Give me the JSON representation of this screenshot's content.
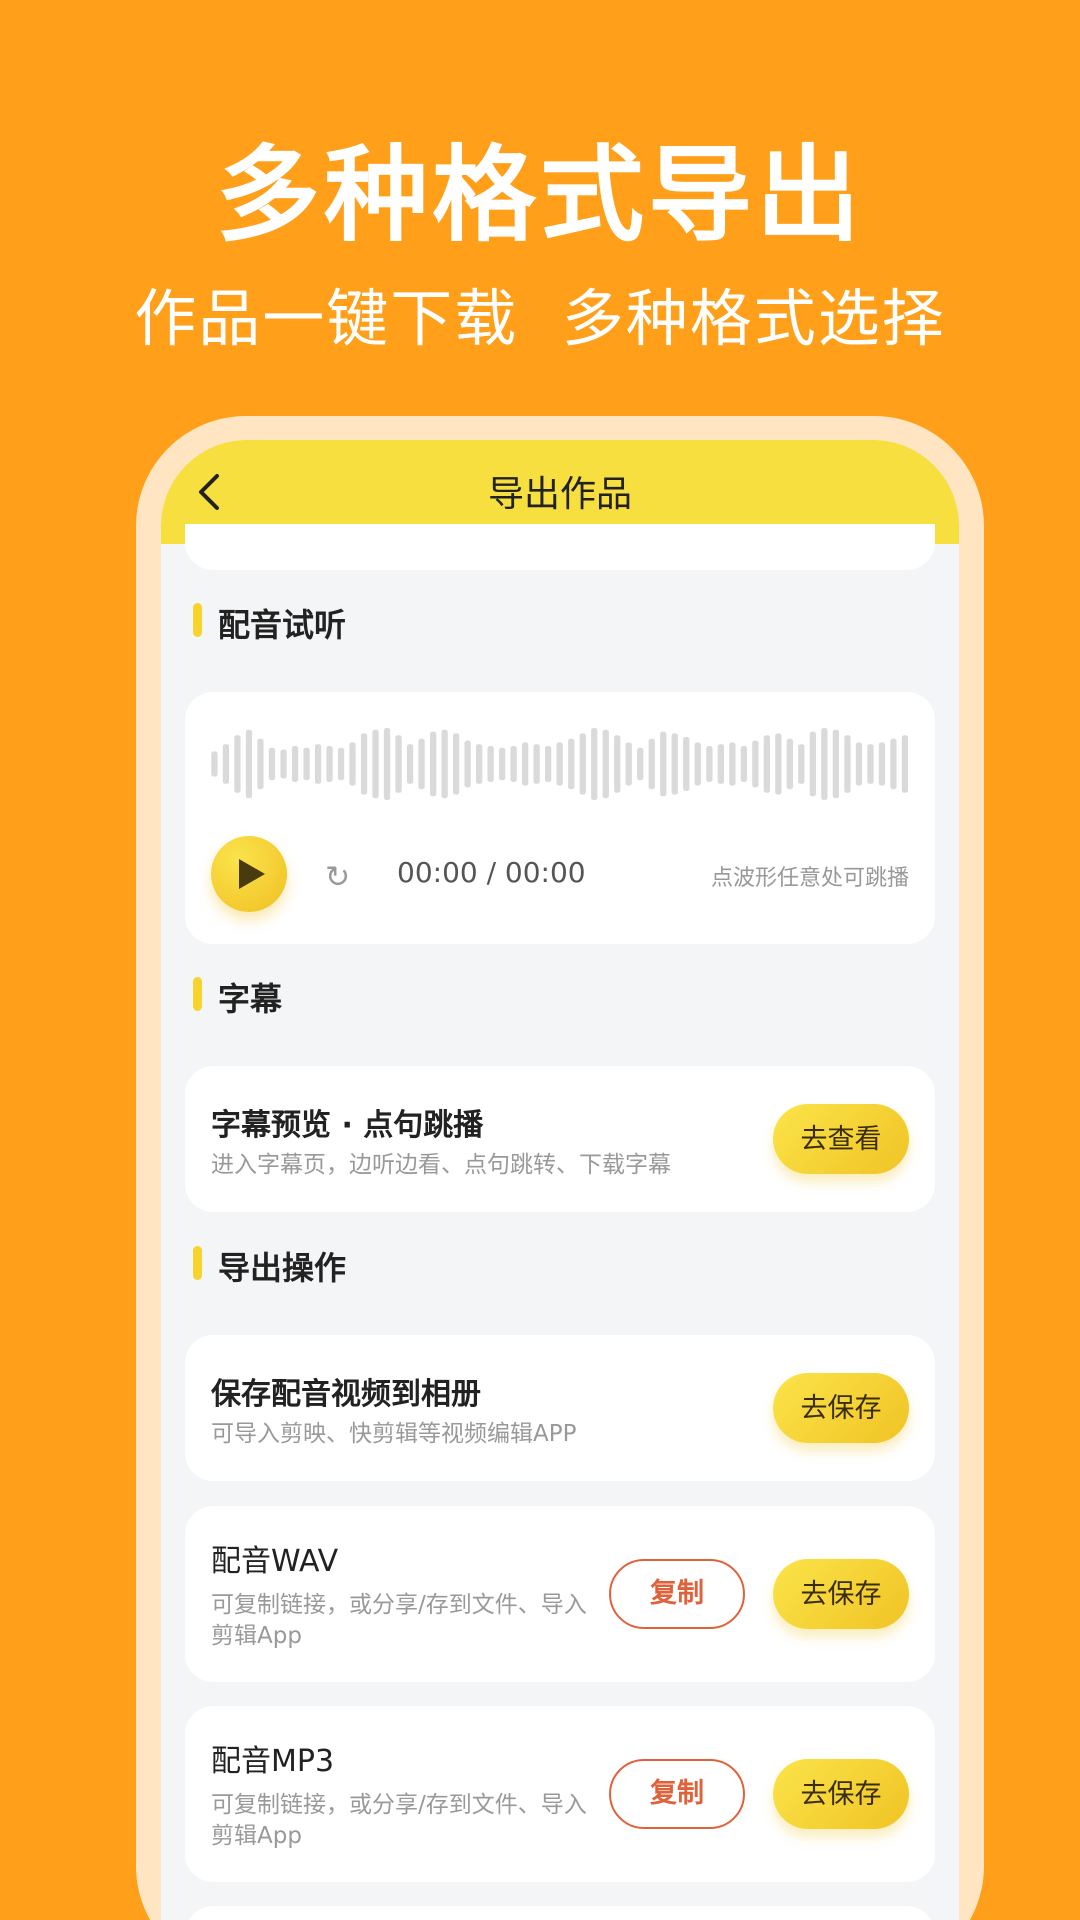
{
  "hero": {
    "title": "多种格式导出",
    "subtitle": "作品一键下载  多种格式选择"
  },
  "nav": {
    "title": "导出作品",
    "back_icon": "chevron-left-icon"
  },
  "sections": {
    "preview": "配音试听",
    "subtitles": "字幕",
    "export": "导出操作"
  },
  "player": {
    "play_icon": "play-icon",
    "replay_icon": "↻",
    "time": "00:00 / 00:00",
    "hint": "点波形任意处可跳播",
    "waveform_levels": [
      0.35,
      0.55,
      0.8,
      0.95,
      0.7,
      0.45,
      0.4,
      0.5,
      0.45,
      0.55,
      0.5,
      0.45,
      0.6,
      0.85,
      0.95,
      1.0,
      0.8,
      0.55,
      0.7,
      0.9,
      0.95,
      0.85,
      0.65,
      0.55,
      0.5,
      0.45,
      0.5,
      0.6,
      0.55,
      0.5,
      0.6,
      0.7,
      0.85,
      1.0,
      0.95,
      0.8,
      0.6,
      0.45,
      0.7,
      0.9,
      0.85,
      0.75,
      0.6,
      0.5,
      0.55,
      0.6,
      0.5,
      0.65,
      0.8,
      0.85,
      0.7,
      0.55,
      0.9,
      1.0,
      0.95,
      0.8,
      0.6,
      0.55,
      0.6,
      0.7,
      0.8
    ]
  },
  "subtitle_card": {
    "title": "字幕预览  ·  点句跳播",
    "desc": "进入字幕页，边听边看、点句跳转、下载字幕",
    "button": "去查看"
  },
  "export_items": [
    {
      "title": "保存配音视频到相册",
      "desc": "可导入剪映、快剪辑等视频编辑APP",
      "save_button": "去保存"
    },
    {
      "title": "配音WAV",
      "desc": "可复制链接，或分享/存到文件、导入剪辑App",
      "copy_button": "复制",
      "save_button": "去保存"
    },
    {
      "title": "配音MP3",
      "desc": "可复制链接，或分享/存到文件、导入剪辑App",
      "copy_button": "复制",
      "save_button": "去保存"
    }
  ],
  "colors": {
    "background": "#FF9F1A",
    "accent_yellow": "#F6DF3E",
    "copy_red": "#E0623A"
  }
}
